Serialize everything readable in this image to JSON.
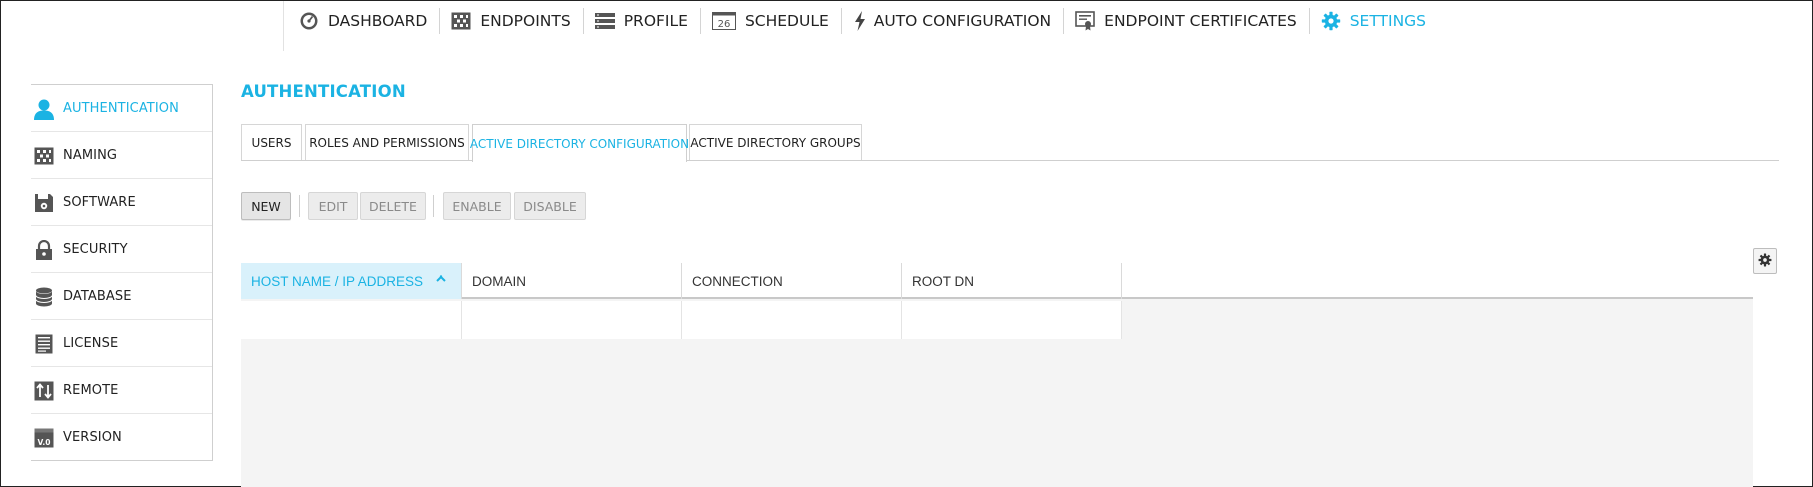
{
  "topnav": {
    "items": [
      {
        "label": "DASHBOARD",
        "icon": "dashboard-gauge-icon"
      },
      {
        "label": "ENDPOINTS",
        "icon": "endpoints-grid-icon"
      },
      {
        "label": "PROFILE",
        "icon": "profile-list-icon"
      },
      {
        "label": "SCHEDULE",
        "icon": "calendar-icon",
        "icon_text": "26"
      },
      {
        "label": "AUTO CONFIGURATION",
        "icon": "lightning-icon"
      },
      {
        "label": "ENDPOINT CERTIFICATES",
        "icon": "certificate-icon"
      },
      {
        "label": "SETTINGS",
        "icon": "gear-icon",
        "active": true
      }
    ]
  },
  "sidebar": {
    "items": [
      {
        "label": "AUTHENTICATION",
        "icon": "user-icon",
        "active": true
      },
      {
        "label": "NAMING",
        "icon": "naming-grid-icon"
      },
      {
        "label": "SOFTWARE",
        "icon": "software-disk-icon"
      },
      {
        "label": "SECURITY",
        "icon": "lock-icon"
      },
      {
        "label": "DATABASE",
        "icon": "database-icon"
      },
      {
        "label": "LICENSE",
        "icon": "license-document-icon"
      },
      {
        "label": "REMOTE",
        "icon": "remote-arrows-icon"
      },
      {
        "label": "VERSION",
        "icon": "version-icon",
        "icon_text": "V.0"
      }
    ]
  },
  "main": {
    "title": "AUTHENTICATION",
    "tabs": [
      {
        "label": "USERS"
      },
      {
        "label": "ROLES AND PERMISSIONS"
      },
      {
        "label": "ACTIVE DIRECTORY CONFIGURATION",
        "active": true
      },
      {
        "label": "ACTIVE DIRECTORY GROUPS"
      }
    ],
    "toolbar": {
      "new_label": "NEW",
      "edit_label": "EDIT",
      "delete_label": "DELETE",
      "enable_label": "ENABLE",
      "disable_label": "DISABLE"
    },
    "table": {
      "columns": [
        {
          "label": "HOST NAME / IP ADDRESS",
          "sorted": "ascending"
        },
        {
          "label": "DOMAIN"
        },
        {
          "label": "CONNECTION"
        },
        {
          "label": "ROOT DN"
        }
      ],
      "rows": [
        [
          "",
          "",
          "",
          ""
        ]
      ]
    }
  },
  "colors": {
    "accent": "#1bb3e3",
    "sorted_header_bg": "#d9f1fb",
    "grid_bg": "#f4f4f4",
    "text": "#222222"
  }
}
